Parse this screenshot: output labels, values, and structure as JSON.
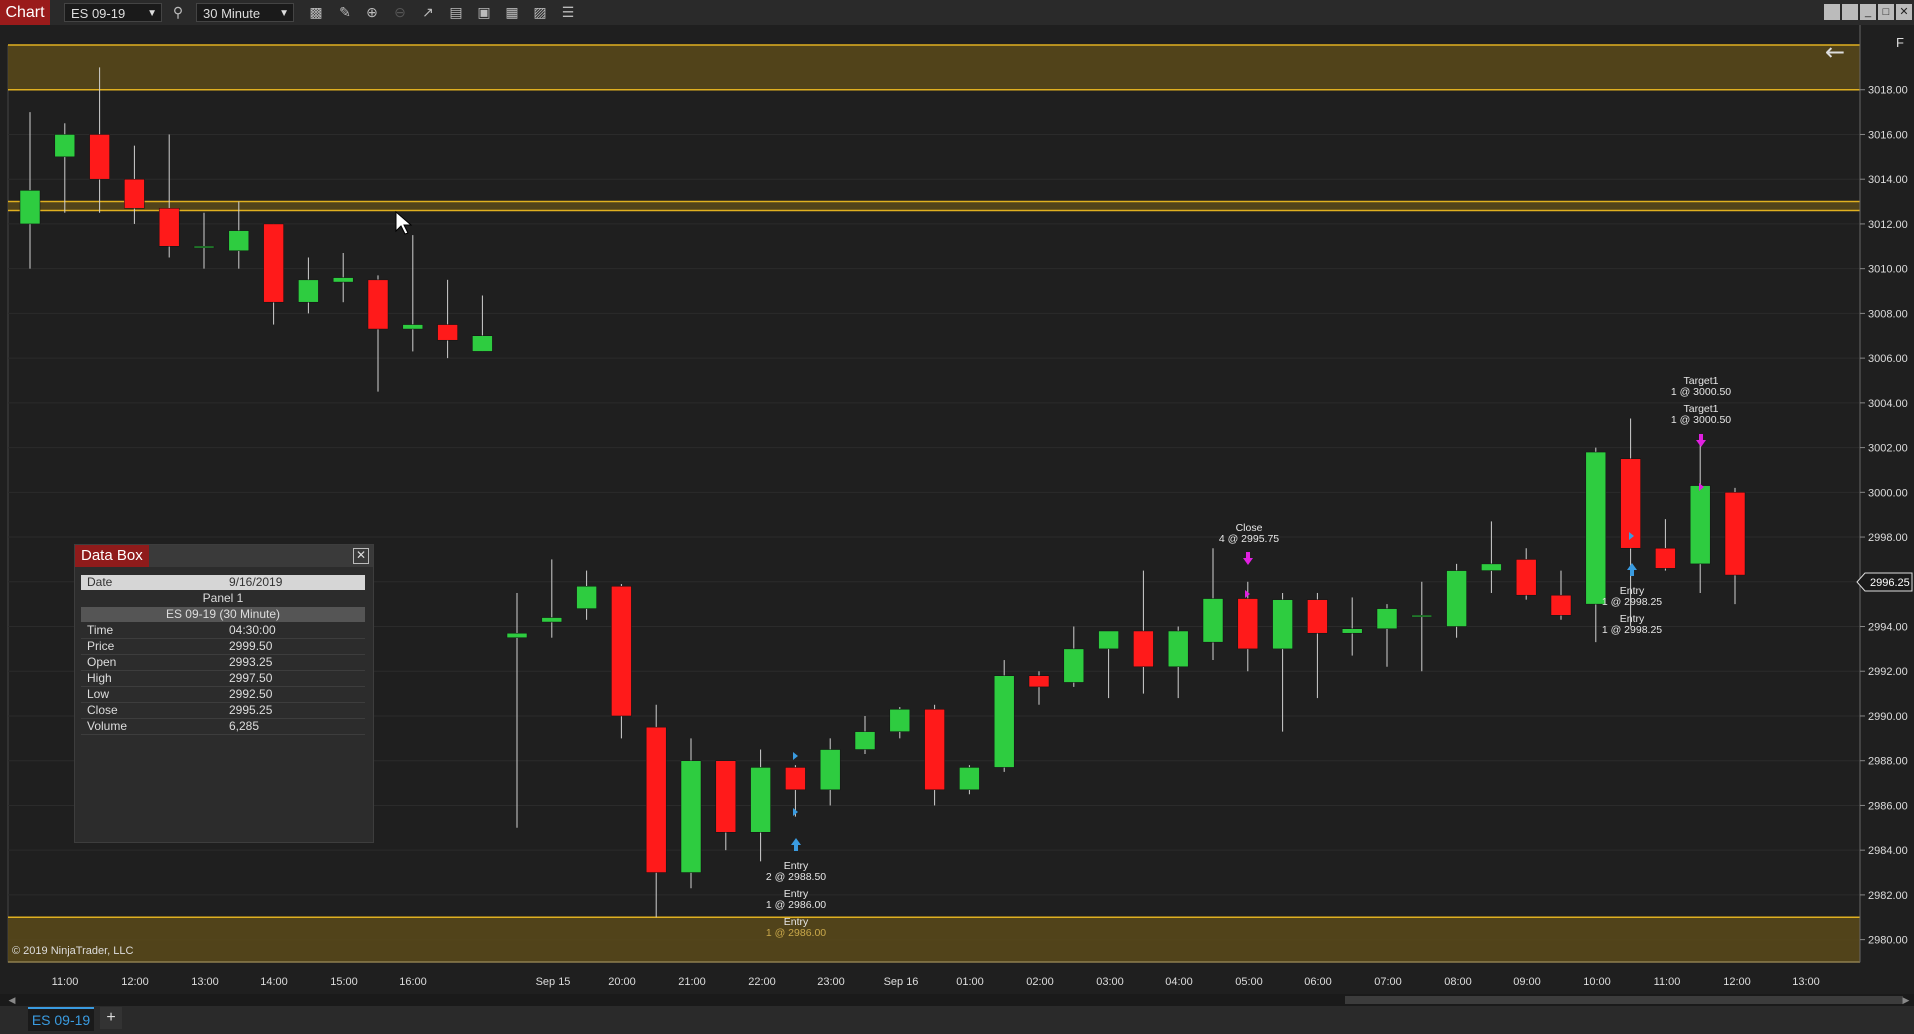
{
  "window": {
    "tab_label": "Chart",
    "instrument": "ES 09-19",
    "interval": "30 Minute",
    "tool_icons": [
      "bar-chart-icon",
      "pencil-icon",
      "zoom-in-icon",
      "zoom-out-icon",
      "pointer-icon",
      "properties-icon",
      "template-icon",
      "layout-icon",
      "strategy-icon",
      "list-icon"
    ],
    "window_icons": [
      "minimize-icon",
      "restore-icon",
      "maximize-icon",
      "close-icon"
    ]
  },
  "chart": {
    "copyright": "© 2019 NinjaTrader, LLC",
    "back_arrow": "←",
    "panel_letter": "F",
    "current_price_label": "2996.25",
    "price_ticks": [
      "3018.00",
      "3016.00",
      "3014.00",
      "3012.00",
      "3010.00",
      "3008.00",
      "3006.00",
      "3004.00",
      "3002.00",
      "3000.00",
      "2998.00",
      "2996.00",
      "2994.00",
      "2992.00",
      "2990.00",
      "2988.00",
      "2986.00",
      "2984.00",
      "2982.00",
      "2980.00"
    ],
    "time_labels": [
      "11:00",
      "12:00",
      "13:00",
      "14:00",
      "15:00",
      "16:00",
      "Sep 15",
      "20:00",
      "21:00",
      "22:00",
      "23:00",
      "Sep 16",
      "01:00",
      "02:00",
      "03:00",
      "04:00",
      "05:00",
      "06:00",
      "07:00",
      "08:00",
      "09:00",
      "10:00",
      "11:00",
      "12:00",
      "13:00"
    ],
    "annotations": [
      {
        "text": "Entry"
      },
      {
        "text": "2 @ 2988.50"
      },
      {
        "text": "Entry"
      },
      {
        "text": "1 @ 2986.00"
      },
      {
        "text": "Entry"
      },
      {
        "text": "1 @ 2986.00"
      },
      {
        "text": "Close"
      },
      {
        "text": "4 @ 2995.75"
      },
      {
        "text": "Entry"
      },
      {
        "text": "1 @ 2998.25"
      },
      {
        "text": "Entry"
      },
      {
        "text": "1 @ 2998.25"
      },
      {
        "text": "Target1"
      },
      {
        "text": "1 @ 3000.50"
      },
      {
        "text": "Target1"
      },
      {
        "text": "1 @ 3000.50"
      }
    ],
    "colors": {
      "up": "#2ecc40",
      "down": "#ff1a1a",
      "zone": "#5a4a1a",
      "zone_line": "#e0b020",
      "bg": "#1f1f1f",
      "entry_arrow": "#3a9be0",
      "exit_arrow": "#e020e0"
    }
  },
  "chart_data": {
    "type": "candlestick",
    "instrument": "ES 09-19",
    "interval": "30 Minute",
    "ylim": [
      2979,
      3020
    ],
    "zones": [
      {
        "from": 3018.0,
        "to": 3020.0
      },
      {
        "from": 3012.6,
        "to": 3013.0
      },
      {
        "from": 2979.0,
        "to": 2981.0
      }
    ],
    "candles": [
      {
        "t": "10:30",
        "o": 3012.0,
        "h": 3017.0,
        "l": 3010.0,
        "c": 3013.5
      },
      {
        "t": "11:00",
        "o": 3015.0,
        "h": 3016.5,
        "l": 3012.5,
        "c": 3016.0
      },
      {
        "t": "11:30",
        "o": 3016.0,
        "h": 3019.0,
        "l": 3012.5,
        "c": 3014.0
      },
      {
        "t": "12:00",
        "o": 3014.0,
        "h": 3015.5,
        "l": 3012.0,
        "c": 3012.7
      },
      {
        "t": "12:30",
        "o": 3012.7,
        "h": 3016.0,
        "l": 3010.5,
        "c": 3011.0
      },
      {
        "t": "13:00",
        "o": 3011.0,
        "h": 3012.5,
        "l": 3010.0,
        "c": 3011.0
      },
      {
        "t": "13:30",
        "o": 3010.8,
        "h": 3013.0,
        "l": 3010.0,
        "c": 3011.7
      },
      {
        "t": "14:00",
        "o": 3012.0,
        "h": 3012.0,
        "l": 3007.5,
        "c": 3008.5
      },
      {
        "t": "14:30",
        "o": 3008.5,
        "h": 3010.5,
        "l": 3008.0,
        "c": 3009.5
      },
      {
        "t": "15:00",
        "o": 3009.4,
        "h": 3010.7,
        "l": 3008.5,
        "c": 3009.6
      },
      {
        "t": "15:30",
        "o": 3009.5,
        "h": 3009.7,
        "l": 3004.5,
        "c": 3007.3
      },
      {
        "t": "16:00",
        "o": 3007.3,
        "h": 3011.5,
        "l": 3006.3,
        "c": 3007.5
      },
      {
        "t": "16:30",
        "o": 3007.5,
        "h": 3009.5,
        "l": 3006.0,
        "c": 3006.8
      },
      {
        "t": "17:00",
        "o": 3006.3,
        "h": 3008.8,
        "l": 3006.3,
        "c": 3007.0
      },
      {
        "t": "18:00",
        "o": 2993.5,
        "h": 2995.5,
        "l": 2985.0,
        "c": 2993.7
      },
      {
        "t": "18:30",
        "o": 2994.2,
        "h": 2997.0,
        "l": 2993.5,
        "c": 2994.4
      },
      {
        "t": "19:00",
        "o": 2994.8,
        "h": 2996.5,
        "l": 2994.3,
        "c": 2995.8
      },
      {
        "t": "19:30",
        "o": 2995.8,
        "h": 2995.9,
        "l": 2989.0,
        "c": 2990.0
      },
      {
        "t": "20:00",
        "o": 2989.5,
        "h": 2990.5,
        "l": 2981.0,
        "c": 2983.0
      },
      {
        "t": "20:30",
        "o": 2983.0,
        "h": 2989.0,
        "l": 2982.3,
        "c": 2988.0
      },
      {
        "t": "21:00",
        "o": 2988.0,
        "h": 2988.0,
        "l": 2984.0,
        "c": 2984.8
      },
      {
        "t": "21:30",
        "o": 2984.8,
        "h": 2988.5,
        "l": 2983.5,
        "c": 2987.7
      },
      {
        "t": "22:00",
        "o": 2987.7,
        "h": 2987.8,
        "l": 2985.5,
        "c": 2986.7
      },
      {
        "t": "22:30",
        "o": 2986.7,
        "h": 2989.0,
        "l": 2986.0,
        "c": 2988.5
      },
      {
        "t": "23:00",
        "o": 2988.5,
        "h": 2990.0,
        "l": 2988.3,
        "c": 2989.3
      },
      {
        "t": "23:30",
        "o": 2989.3,
        "h": 2990.4,
        "l": 2989.0,
        "c": 2990.3
      },
      {
        "t": "00:00",
        "o": 2990.3,
        "h": 2990.5,
        "l": 2986.0,
        "c": 2986.7
      },
      {
        "t": "00:30",
        "o": 2986.7,
        "h": 2987.8,
        "l": 2986.5,
        "c": 2987.7
      },
      {
        "t": "01:00",
        "o": 2987.7,
        "h": 2992.5,
        "l": 2987.5,
        "c": 2991.8
      },
      {
        "t": "01:30",
        "o": 2991.8,
        "h": 2992.0,
        "l": 2990.5,
        "c": 2991.3
      },
      {
        "t": "02:00",
        "o": 2991.5,
        "h": 2994.0,
        "l": 2991.3,
        "c": 2993.0
      },
      {
        "t": "02:30",
        "o": 2993.0,
        "h": 2993.8,
        "l": 2990.8,
        "c": 2993.8
      },
      {
        "t": "03:00",
        "o": 2993.8,
        "h": 2996.5,
        "l": 2991.0,
        "c": 2992.2
      },
      {
        "t": "03:30",
        "o": 2992.2,
        "h": 2994.0,
        "l": 2990.8,
        "c": 2993.8
      },
      {
        "t": "04:00",
        "o": 2993.3,
        "h": 2997.5,
        "l": 2992.5,
        "c": 2995.25
      },
      {
        "t": "04:30",
        "o": 2995.25,
        "h": 2996.0,
        "l": 2992.0,
        "c": 2993.0
      },
      {
        "t": "05:00",
        "o": 2993.0,
        "h": 2995.5,
        "l": 2989.3,
        "c": 2995.2
      },
      {
        "t": "05:30",
        "o": 2995.2,
        "h": 2995.5,
        "l": 2990.8,
        "c": 2993.7
      },
      {
        "t": "06:00",
        "o": 2993.7,
        "h": 2995.3,
        "l": 2992.7,
        "c": 2993.9
      },
      {
        "t": "06:30",
        "o": 2993.9,
        "h": 2995.0,
        "l": 2992.2,
        "c": 2994.8
      },
      {
        "t": "07:00",
        "o": 2994.5,
        "h": 2996.0,
        "l": 2992.0,
        "c": 2994.5
      },
      {
        "t": "07:30",
        "o": 2994.0,
        "h": 2996.8,
        "l": 2993.5,
        "c": 2996.5
      },
      {
        "t": "08:00",
        "o": 2996.5,
        "h": 2998.7,
        "l": 2995.5,
        "c": 2996.8
      },
      {
        "t": "08:30",
        "o": 2997.0,
        "h": 2997.5,
        "l": 2995.2,
        "c": 2995.4
      },
      {
        "t": "09:00",
        "o": 2995.4,
        "h": 2996.5,
        "l": 2994.3,
        "c": 2994.5
      },
      {
        "t": "09:30",
        "o": 2995.0,
        "h": 3002.0,
        "l": 2993.3,
        "c": 3001.8
      },
      {
        "t": "10:00",
        "o": 3001.5,
        "h": 3003.3,
        "l": 2994.0,
        "c": 2997.5
      },
      {
        "t": "10:30",
        "o": 2997.5,
        "h": 2998.8,
        "l": 2996.5,
        "c": 2996.6
      },
      {
        "t": "11:00",
        "o": 2996.8,
        "h": 3002.5,
        "l": 2995.5,
        "c": 3000.3
      },
      {
        "t": "11:30",
        "o": 3000.0,
        "h": 3000.2,
        "l": 2995.0,
        "c": 2996.3
      }
    ]
  },
  "data_box": {
    "title": "Data Box",
    "close_label": "✕",
    "date_key": "Date",
    "date_val": "9/16/2019",
    "panel": "Panel 1",
    "series": "ES 09-19 (30 Minute)",
    "rows": [
      {
        "k": "Time",
        "v": "04:30:00"
      },
      {
        "k": "Price",
        "v": "2999.50"
      },
      {
        "k": "Open",
        "v": "2993.25"
      },
      {
        "k": "High",
        "v": "2997.50"
      },
      {
        "k": "Low",
        "v": "2992.50"
      },
      {
        "k": "Close",
        "v": "2995.25"
      },
      {
        "k": "Volume",
        "v": "6,285"
      }
    ]
  },
  "bottom": {
    "tab_label": "ES 09-19",
    "add_label": "+"
  }
}
